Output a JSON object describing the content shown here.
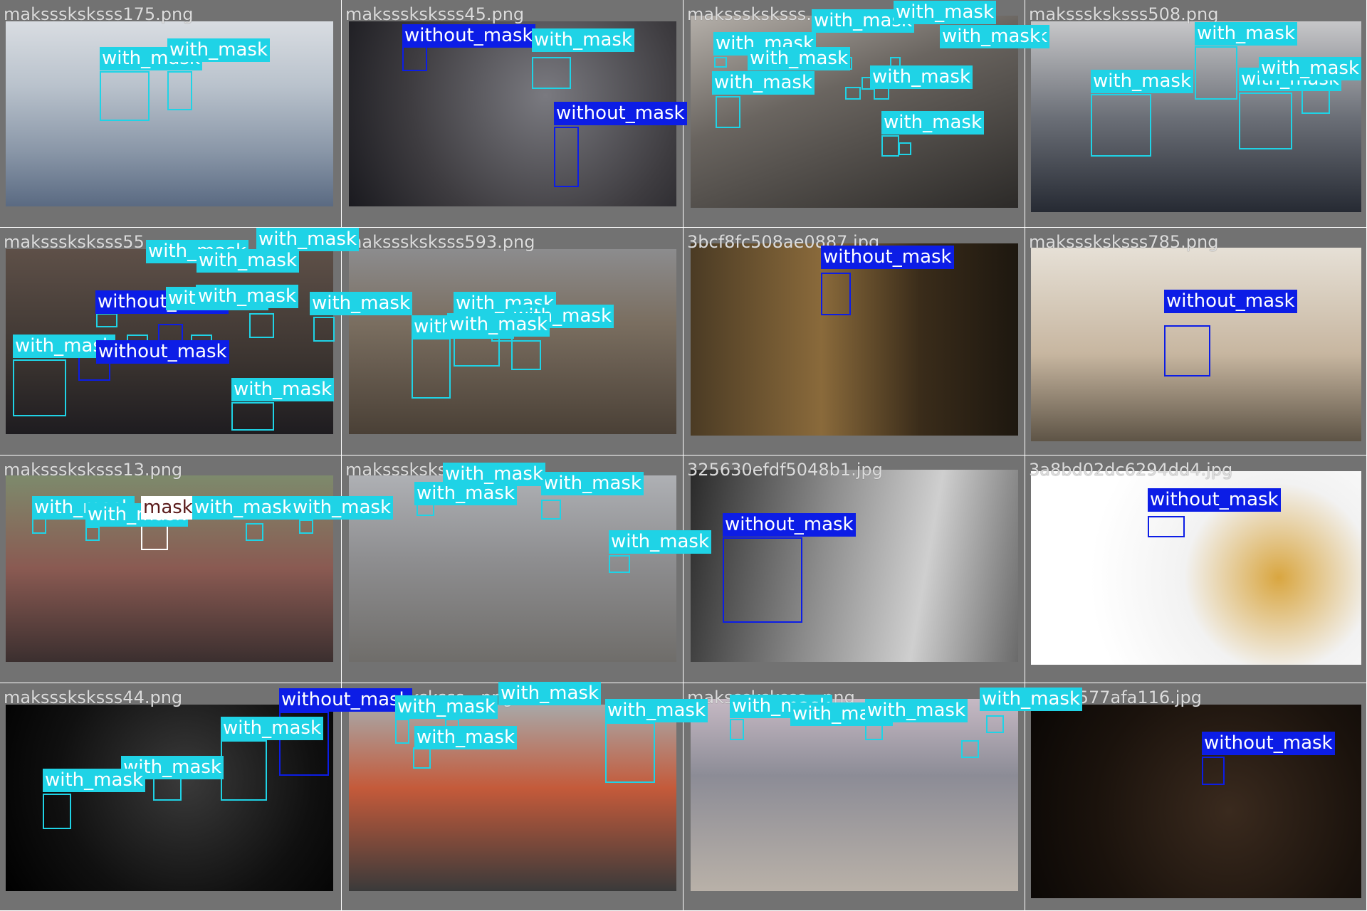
{
  "colors": {
    "with_mask": "#1fd3e6",
    "without_mask": "#0c1de6",
    "mask_tag": "#ffffff"
  },
  "tiles": [
    {
      "filename": "maksssksksss175.png",
      "photo": "p-station",
      "boxes": [
        {
          "cls": "with",
          "label": "with_mask"
        },
        {
          "cls": "with",
          "label": "with_mask"
        }
      ]
    },
    {
      "filename": "maksssksksss45.png",
      "photo": "p-crowd1",
      "boxes": [
        {
          "cls": "without",
          "label": "without_mask"
        },
        {
          "cls": "with",
          "label": "with_mask"
        },
        {
          "cls": "without",
          "label": "without_mask"
        }
      ]
    },
    {
      "filename": "maksssksksss...",
      "photo": "p-crowd2",
      "boxes": [
        {
          "cls": "with",
          "label": "with_mask"
        },
        {
          "cls": "with",
          "label": "with_mask"
        },
        {
          "cls": "with",
          "label": "with_mask"
        },
        {
          "cls": "with",
          "label": "with_mask"
        },
        {
          "cls": "with",
          "label": "with_mask"
        },
        {
          "cls": "with",
          "label": "with_mask"
        },
        {
          "cls": "with",
          "label": "with_mask"
        },
        {
          "cls": "with",
          "label": "with_mask"
        },
        {
          "cls": "with",
          "label": "with_mask"
        }
      ]
    },
    {
      "filename": "maksssksksss508.png",
      "photo": "p-crowd3",
      "boxes": [
        {
          "cls": "with",
          "label": "with_mask"
        },
        {
          "cls": "with",
          "label": "with_mask"
        },
        {
          "cls": "with",
          "label": "with_mask"
        },
        {
          "cls": "with",
          "label": "with_mask"
        }
      ]
    },
    {
      "filename": "maksssksksss55...",
      "photo": "p-crowd4",
      "boxes": [
        {
          "cls": "with",
          "label": "with_mask"
        },
        {
          "cls": "without",
          "label": "without_mask"
        },
        {
          "cls": "with",
          "label": "with_mask"
        },
        {
          "cls": "without",
          "label": "without_mask"
        },
        {
          "cls": "with",
          "label": "with_mask"
        },
        {
          "cls": "with",
          "label": "with_mask"
        },
        {
          "cls": "with",
          "label": "with_mask"
        },
        {
          "cls": "with",
          "label": "with_mask"
        },
        {
          "cls": "with",
          "label": "with_mask"
        },
        {
          "cls": "with",
          "label": "with_mask"
        }
      ]
    },
    {
      "filename": "maksssksksss593.png",
      "photo": "p-street",
      "boxes": [
        {
          "cls": "with",
          "label": "with_mask"
        },
        {
          "cls": "with",
          "label": "with_mask"
        },
        {
          "cls": "with",
          "label": "with_mask"
        },
        {
          "cls": "with",
          "label": "with_mask"
        }
      ]
    },
    {
      "filename": "3bcf8fc508ae0887.jpg",
      "photo": "p-guitar",
      "boxes": [
        {
          "cls": "without",
          "label": "without_mask"
        }
      ]
    },
    {
      "filename": "maksssksksss785.png",
      "photo": "p-man",
      "boxes": [
        {
          "cls": "without",
          "label": "without_mask"
        }
      ]
    },
    {
      "filename": "maksssksksss13.png",
      "photo": "p-market",
      "boxes": [
        {
          "cls": "with",
          "label": "with_mask"
        },
        {
          "cls": "with",
          "label": "with_mask"
        },
        {
          "cls": "tag",
          "label": "mask"
        },
        {
          "cls": "with",
          "label": "with_mask"
        },
        {
          "cls": "with",
          "label": "with_mask"
        }
      ]
    },
    {
      "filename": "maksssksksss...png",
      "photo": "p-road",
      "boxes": [
        {
          "cls": "with",
          "label": "with_mask"
        },
        {
          "cls": "with",
          "label": "with_mask"
        },
        {
          "cls": "with",
          "label": "with_mask"
        },
        {
          "cls": "with",
          "label": "with_mask"
        }
      ]
    },
    {
      "filename": "325630efdf5048b1.jpg",
      "photo": "p-bw",
      "boxes": [
        {
          "cls": "without",
          "label": "without_mask"
        }
      ]
    },
    {
      "filename": "3a8bd02dc6294dd4.jpg",
      "photo": "p-lego",
      "boxes": [
        {
          "cls": "without",
          "label": "without_mask"
        }
      ]
    },
    {
      "filename": "maksssksksss44.png",
      "photo": "p-dark",
      "boxes": [
        {
          "cls": "without",
          "label": "without_mask"
        },
        {
          "cls": "with",
          "label": "with_mask"
        },
        {
          "cls": "with",
          "label": "with_mask"
        },
        {
          "cls": "with",
          "label": "with_mask"
        }
      ]
    },
    {
      "filename": "maksssksksss...png",
      "photo": "p-barrier",
      "boxes": [
        {
          "cls": "with",
          "label": "with_mask"
        },
        {
          "cls": "with",
          "label": "with_mask"
        },
        {
          "cls": "with",
          "label": "with_mask"
        },
        {
          "cls": "with",
          "label": "with_mask"
        }
      ]
    },
    {
      "filename": "maksssksksss...png",
      "photo": "p-airport",
      "boxes": [
        {
          "cls": "with",
          "label": "with_mask"
        },
        {
          "cls": "with",
          "label": "with_mask"
        },
        {
          "cls": "with",
          "label": "with_mask"
        },
        {
          "cls": "with",
          "label": "with_mask"
        }
      ]
    },
    {
      "filename": "...125577afa116.jpg",
      "photo": "p-night",
      "boxes": [
        {
          "cls": "without",
          "label": "without_mask"
        }
      ]
    }
  ]
}
